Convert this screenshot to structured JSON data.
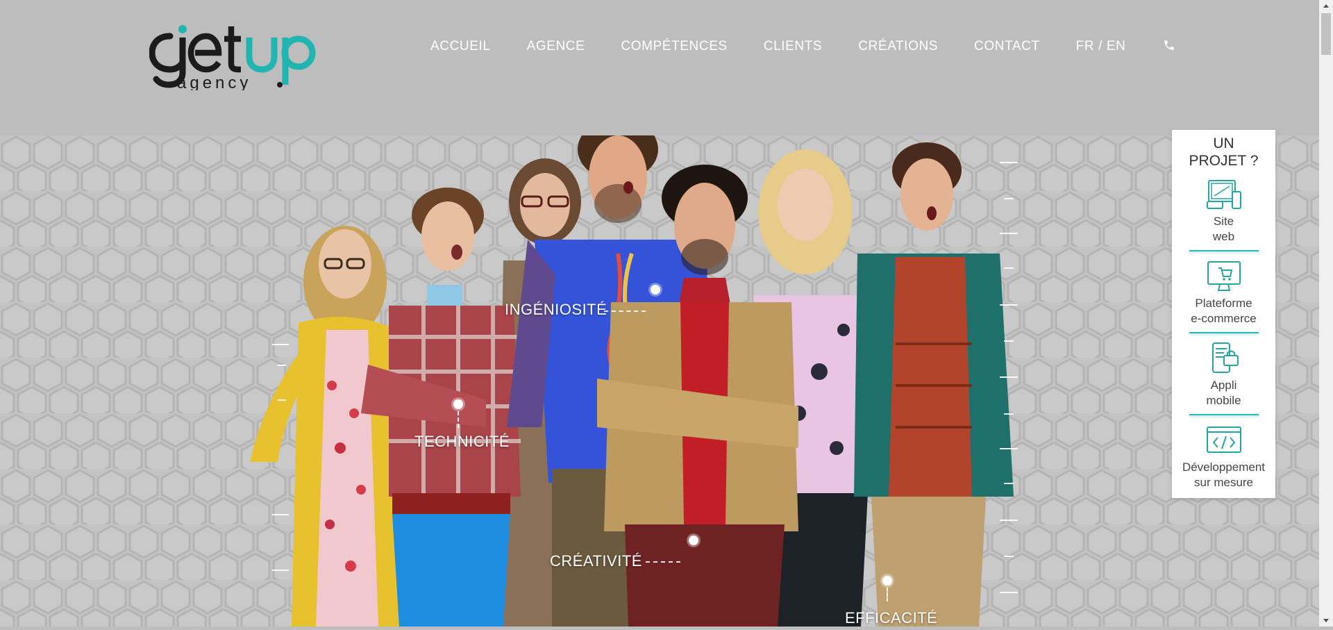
{
  "brand": {
    "logo_top": "getup",
    "logo_bottom": "agency",
    "accent": "#20b5b0",
    "dark": "#1b1b1b"
  },
  "nav": {
    "items": [
      {
        "label": "ACCUEIL"
      },
      {
        "label": "AGENCE"
      },
      {
        "label": "COMPÉTENCES"
      },
      {
        "label": "CLIENTS"
      },
      {
        "label": "CRÉATIONS"
      },
      {
        "label": "CONTACT"
      }
    ],
    "lang": "FR / EN",
    "phone_icon": "phone-icon"
  },
  "hero": {
    "labels": {
      "ingeniosite": "INGÉNIOSITÉ",
      "technicite": "TECHNICITÉ",
      "creativite": "CRÉATIVITÉ",
      "efficacite": "EFFICACITÉ"
    }
  },
  "panel": {
    "title_line1": "UN",
    "title_line2": "PROJET ?",
    "items": [
      {
        "line1": "Site",
        "line2": "web",
        "icon": "devices-icon"
      },
      {
        "line1": "Plateforme",
        "line2": "e-commerce",
        "icon": "ecommerce-monitor-icon"
      },
      {
        "line1": "Appli",
        "line2": "mobile",
        "icon": "mobile-app-icon"
      },
      {
        "line1": "Développement",
        "line2": "sur mesure",
        "icon": "code-window-icon"
      }
    ]
  }
}
